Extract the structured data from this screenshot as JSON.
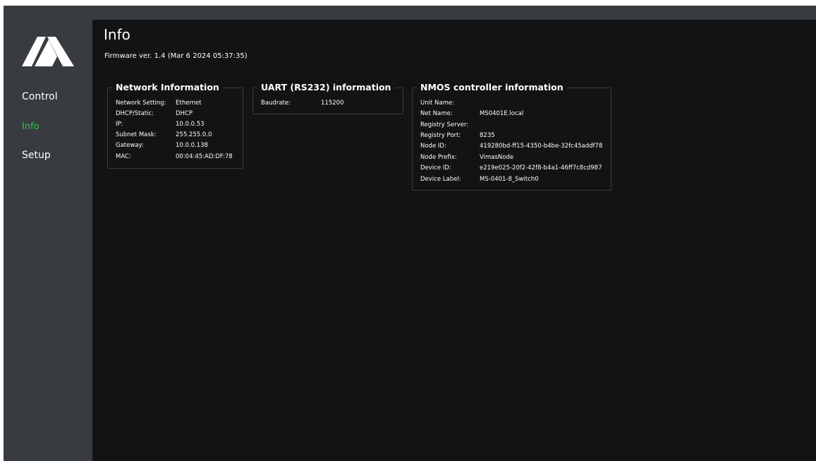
{
  "app": {
    "logo": "brand-logo"
  },
  "sidebar": {
    "items": [
      {
        "label": "Control",
        "active": false
      },
      {
        "label": "Info",
        "active": true
      },
      {
        "label": "Setup",
        "active": false
      }
    ]
  },
  "page": {
    "title": "Info",
    "firmware": "Firmware ver. 1.4 (Mar 6 2024 05:37:35)"
  },
  "network": {
    "title": "Network Information",
    "rows": [
      {
        "key": "Network Setting:",
        "value": "Ethernet"
      },
      {
        "key": "DHCP/Static:",
        "value": "DHCP"
      },
      {
        "key": "IP:",
        "value": "10.0.0.53"
      },
      {
        "key": "Subnet Mask:",
        "value": "255.255.0.0"
      },
      {
        "key": "Gateway:",
        "value": "10.0.0.138"
      },
      {
        "key": "MAC:",
        "value": "00:04:45:AD:DF:78"
      }
    ]
  },
  "uart": {
    "title": "UART (RS232) information",
    "rows": [
      {
        "key": "Baudrate:",
        "value": "115200"
      }
    ]
  },
  "nmos": {
    "title": "NMOS controller information",
    "rows": [
      {
        "key": "Unit Name:",
        "value": ""
      },
      {
        "key": "Net Name:",
        "value": "MS0401E.local"
      },
      {
        "key": "Registry Server:",
        "value": ""
      },
      {
        "key": "Registry Port:",
        "value": "8235"
      },
      {
        "key": "Node ID:",
        "value": "419280bd-ff15-4350-b4be-32fc45addf78"
      },
      {
        "key": "Node Prefix:",
        "value": "VimasNode"
      },
      {
        "key": "Device ID:",
        "value": "e219e025-20f2-42f8-b4a1-46ff7c8cd987"
      },
      {
        "key": "Device Label:",
        "value": "MS-0401-8_Switch0"
      }
    ]
  },
  "colors": {
    "background": "#111314",
    "sidebar": "#383b3f",
    "active": "#2ecc40",
    "border": "#3a3d40"
  }
}
